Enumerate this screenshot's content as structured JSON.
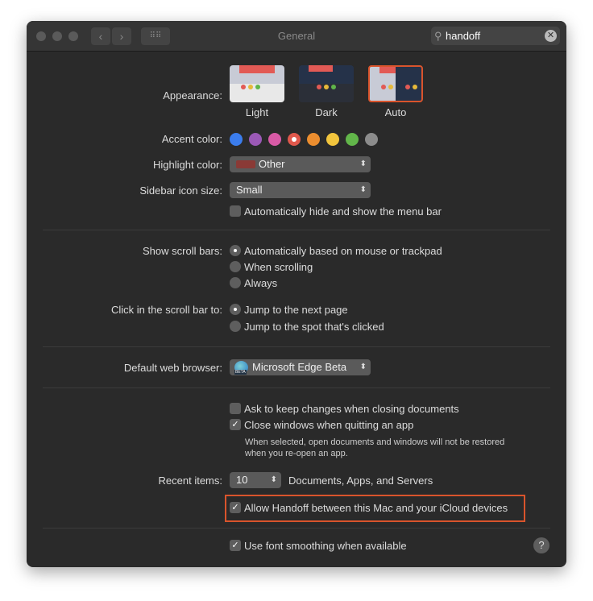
{
  "window": {
    "title": "General",
    "search_value": "handoff",
    "icons": {
      "search": "magnifier-icon",
      "clear": "clear-icon",
      "back": "chevron-left-icon",
      "forward": "chevron-right-icon",
      "grid": "grid-icon"
    }
  },
  "appearance": {
    "label": "Appearance:",
    "options": [
      "Light",
      "Dark",
      "Auto"
    ],
    "selected": "Auto"
  },
  "accent": {
    "label": "Accent color:",
    "colors": [
      "#3b7ded",
      "#9b59b6",
      "#d85aa6",
      "#e0584c",
      "#ec8e2f",
      "#f2c53d",
      "#62b64a",
      "#8c8c8c"
    ],
    "selected_index": 3
  },
  "highlight": {
    "label": "Highlight color:",
    "value": "Other",
    "swatch": "#8a3a36"
  },
  "sidebar": {
    "label": "Sidebar icon size:",
    "value": "Small"
  },
  "menubar": {
    "label": "Automatically hide and show the menu bar",
    "checked": false
  },
  "scrollbars": {
    "label": "Show scroll bars:",
    "options": [
      "Automatically based on mouse or trackpad",
      "When scrolling",
      "Always"
    ],
    "selected_index": 0
  },
  "click": {
    "label": "Click in the scroll bar to:",
    "options": [
      "Jump to the next page",
      "Jump to the spot that's clicked"
    ],
    "selected_index": 0
  },
  "browser": {
    "label": "Default web browser:",
    "value": "Microsoft Edge Beta",
    "badge": "BETA"
  },
  "ask": {
    "label": "Ask to keep changes when closing documents",
    "checked": false
  },
  "close": {
    "label": "Close windows when quitting an app",
    "checked": true,
    "note1": "When selected, open documents and windows will not be restored",
    "note2": "when you re-open an app."
  },
  "recent": {
    "label": "Recent items:",
    "value": "10",
    "suffix": "Documents, Apps, and Servers"
  },
  "handoff": {
    "label": "Allow Handoff between this Mac and your iCloud devices",
    "checked": true,
    "highlight": "#d9542c"
  },
  "smoothing": {
    "label": "Use font smoothing when available",
    "checked": true
  },
  "help": "?"
}
